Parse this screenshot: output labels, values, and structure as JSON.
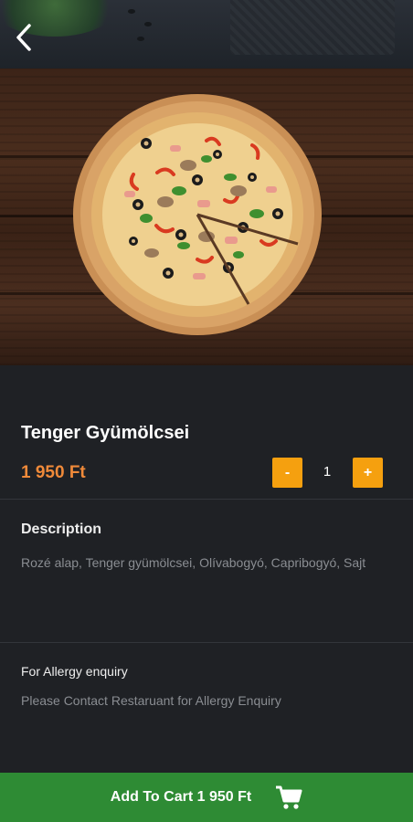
{
  "header": {
    "back_icon": "chevron-left-icon"
  },
  "product": {
    "name": "Tenger Gyümölcsei",
    "price": "1 950 Ft",
    "quantity": "1",
    "decrement_label": "-",
    "increment_label": "+"
  },
  "description": {
    "heading": "Description",
    "text": "Rozé alap, Tenger gyümölcsei, Olívabogyó, Capribogyó, Sajt"
  },
  "allergy": {
    "heading": "For Allergy enquiry",
    "text": "Please Contact Restaruant for Allergy Enquiry"
  },
  "cart": {
    "label": "Add To Cart 1 950 Ft",
    "icon": "shopping-cart-icon"
  },
  "colors": {
    "accent": "#f5a00f",
    "price": "#f08a3a",
    "cart_bar": "#2e8b34",
    "background": "#1f2125"
  }
}
